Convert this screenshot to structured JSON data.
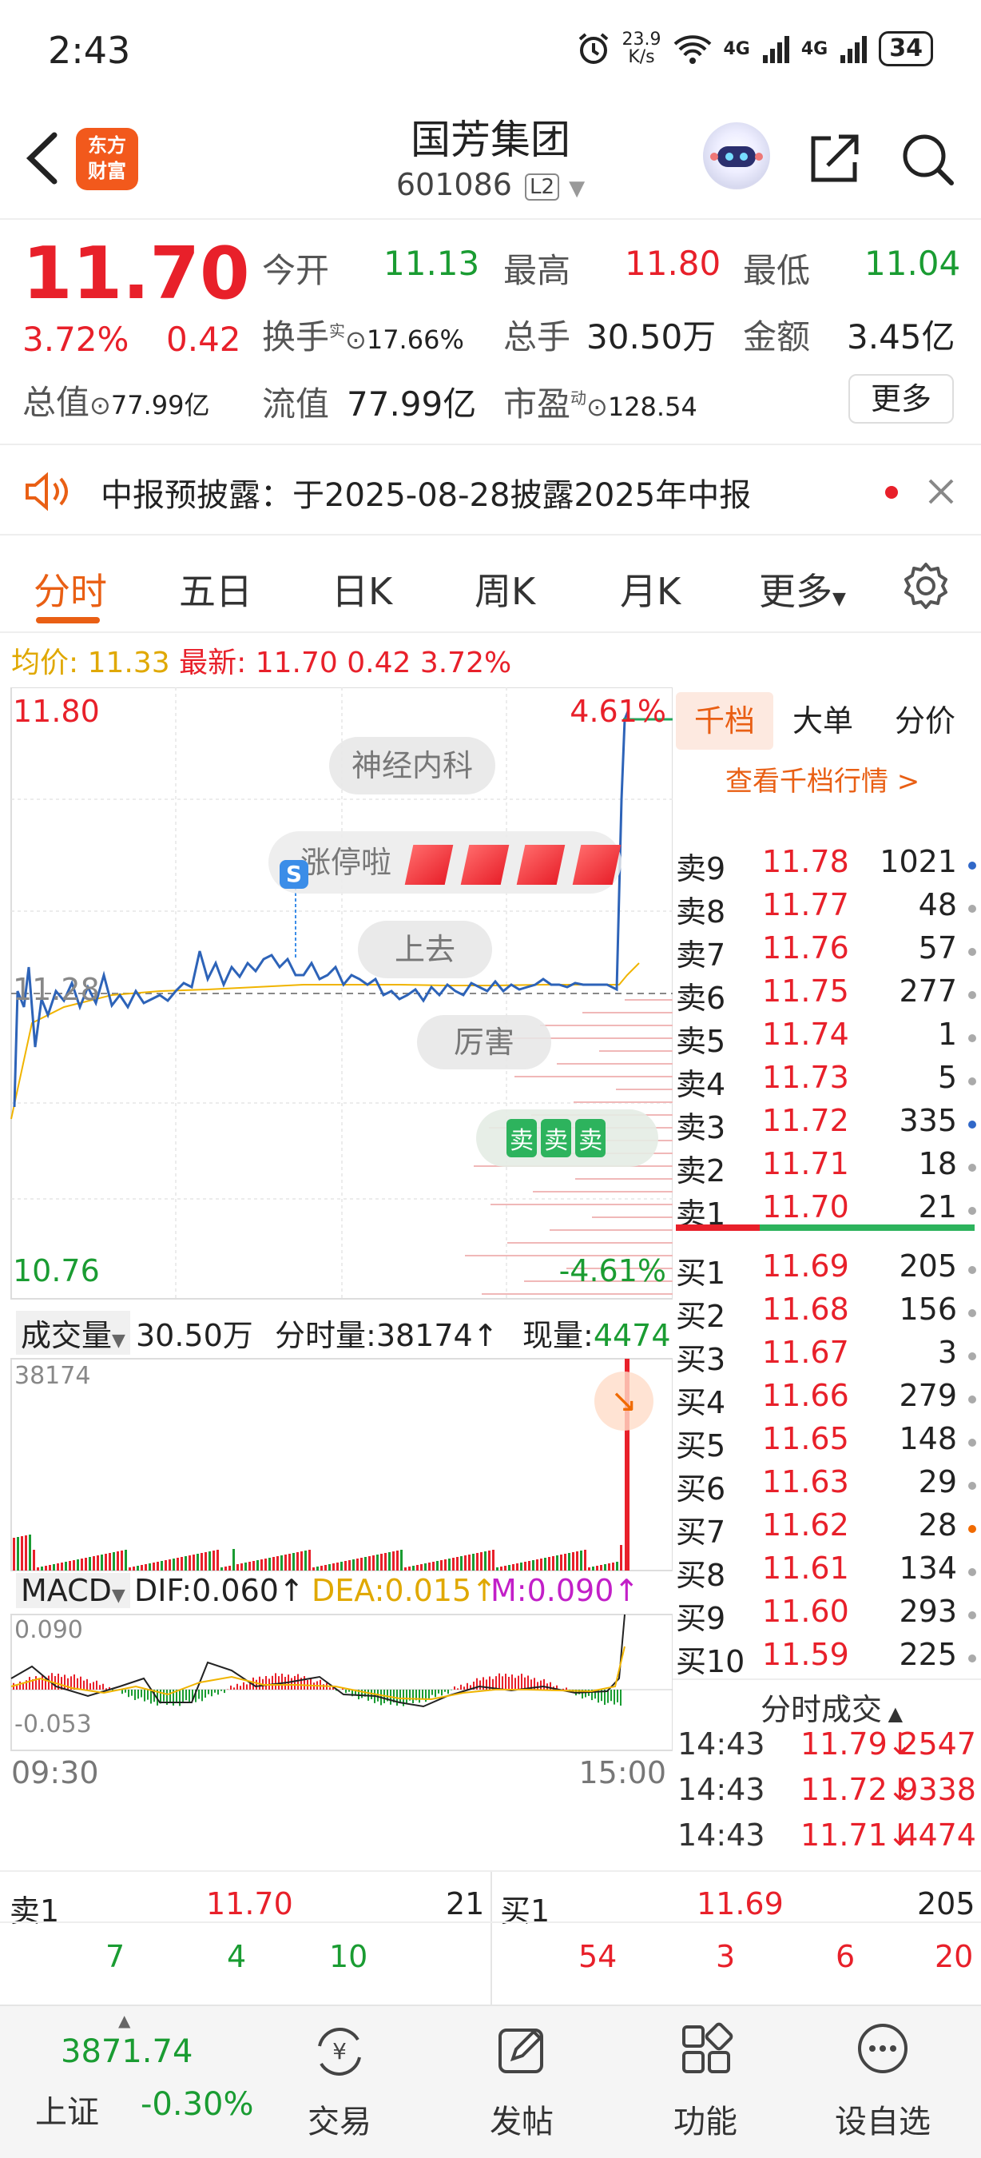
{
  "status": {
    "time": "2:43",
    "speed": "23.9\nK/s",
    "net1": "4G",
    "net2": "4G",
    "battery": "34"
  },
  "header": {
    "logo_line1": "东方",
    "logo_line2": "财富",
    "title": "国芳集团",
    "code": "601086",
    "level": "L2"
  },
  "quote": {
    "price": "11.70",
    "pct": "3.72%",
    "chg": "0.42",
    "open_label": "今开",
    "open": "11.13",
    "high_label": "最高",
    "high": "11.80",
    "low_label": "最低",
    "low": "11.04",
    "turnover_label": "换手",
    "turnover_sup": "实",
    "turnover": "17.66%",
    "volume_label": "总手",
    "volume": "30.50万",
    "amount_label": "金额",
    "amount": "3.45亿",
    "mcap_label": "总值",
    "mcap": "77.99亿",
    "float_label": "流值",
    "float": "77.99亿",
    "pe_label": "市盈",
    "pe_sup": "动",
    "pe": "128.54",
    "more": "更多"
  },
  "notice": {
    "text": "中报预披露：于2025-08-28披露2025年中报"
  },
  "tabs": [
    "分时",
    "五日",
    "日K",
    "周K",
    "月K",
    "更多"
  ],
  "avg": {
    "label": "均价:",
    "value": "11.33",
    "latest_label": "最新:",
    "latest": "11.70",
    "chg": "0.42",
    "pct": "3.72%"
  },
  "chart": {
    "top_price": "11.80",
    "top_pct": "4.61%",
    "bottom_price": "10.76",
    "bottom_pct": "-4.61%",
    "mid_price": "11.28",
    "bubble1": "神经内科",
    "bubble2": "涨停啦",
    "bubble3": "上去",
    "bubble4": "厉害",
    "sell_tag": "卖",
    "vol_label": "成交量",
    "vol_total": "30.50万",
    "vol_minute_label": "分时量:",
    "vol_minute": "38174↑",
    "vol_now_label": "现量:",
    "vol_now": "4474",
    "vol_max": "38174",
    "macd_label": "MACD",
    "dif": "DIF:0.060↑",
    "dea": "DEA:0.015↑",
    "m": "M:0.090↑",
    "macd_max": "0.090",
    "macd_min": "-0.053",
    "t_start": "09:30",
    "t_end": "15:00"
  },
  "chart_data": {
    "type": "line",
    "title": "",
    "x": [
      "09:30",
      "15:00"
    ],
    "ylim": [
      10.76,
      11.8
    ],
    "series": [
      {
        "name": "",
        "values": [
          11.13,
          11.28,
          11.33,
          11.24,
          11.3,
          11.38,
          11.32,
          11.26,
          11.28,
          11.24,
          11.27,
          11.27,
          11.8,
          11.7
        ]
      }
    ]
  },
  "book": {
    "tab1": "千档",
    "tab2": "大单",
    "tab3": "分价",
    "link": "查看千档行情 >",
    "sell": [
      [
        "卖9",
        "11.78",
        "1021",
        "blue"
      ],
      [
        "卖8",
        "11.77",
        "48",
        "gray"
      ],
      [
        "卖7",
        "11.76",
        "57",
        "gray"
      ],
      [
        "卖6",
        "11.75",
        "277",
        "gray"
      ],
      [
        "卖5",
        "11.74",
        "1",
        "gray"
      ],
      [
        "卖4",
        "11.73",
        "5",
        "gray"
      ],
      [
        "卖3",
        "11.72",
        "335",
        "blue"
      ],
      [
        "卖2",
        "11.71",
        "18",
        "gray"
      ],
      [
        "卖1",
        "11.70",
        "21",
        "gray"
      ]
    ],
    "buy": [
      [
        "买1",
        "11.69",
        "205",
        "gray"
      ],
      [
        "买2",
        "11.68",
        "156",
        "gray"
      ],
      [
        "买3",
        "11.67",
        "3",
        "gray"
      ],
      [
        "买4",
        "11.66",
        "279",
        "gray"
      ],
      [
        "买5",
        "11.65",
        "148",
        "gray"
      ],
      [
        "买6",
        "11.63",
        "29",
        "gray"
      ],
      [
        "买7",
        "11.62",
        "28",
        "orange"
      ],
      [
        "买8",
        "11.61",
        "134",
        "gray"
      ],
      [
        "买9",
        "11.60",
        "293",
        "gray"
      ],
      [
        "买10",
        "11.59",
        "225",
        "gray"
      ]
    ],
    "trade_title": "分时成交",
    "trades": [
      [
        "14:43",
        "11.79↓",
        "2547"
      ],
      [
        "14:43",
        "11.72↓",
        "9338"
      ],
      [
        "14:43",
        "11.71↓",
        "4474"
      ]
    ]
  },
  "bottom": {
    "sell_label": "卖1",
    "sell_price": "11.70",
    "sell_vol": "21",
    "buy_label": "买1",
    "buy_price": "11.69",
    "buy_vol": "205",
    "sell_queue": [
      "7",
      "4",
      "10"
    ],
    "buy_queue": [
      "54",
      "3",
      "6",
      "20"
    ]
  },
  "nav": {
    "index": "3871.74",
    "index_name": "上证",
    "index_pct": "-0.30%",
    "trade": "交易",
    "post": "发帖",
    "func": "功能",
    "watch": "设自选"
  }
}
